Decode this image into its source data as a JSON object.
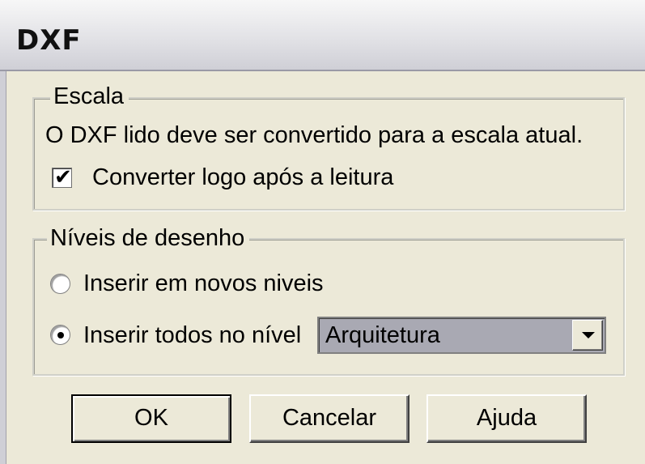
{
  "window": {
    "title": "DXF"
  },
  "escala_group": {
    "legend": "Escala",
    "description": "O DXF lido deve ser convertido para a escala atual.",
    "convert_checkbox": {
      "label": "Converter logo após a leitura",
      "checked": true
    }
  },
  "niveis_group": {
    "legend": "Níveis de desenho",
    "radio_new_levels": {
      "label": "Inserir em novos niveis",
      "selected": false
    },
    "radio_all_in_level": {
      "label": "Inserir todos no nível",
      "selected": true
    },
    "level_select": {
      "value": "Arquitetura"
    }
  },
  "buttons": {
    "ok": "OK",
    "cancel": "Cancelar",
    "help": "Ajuda"
  },
  "icons": {
    "check": "check-icon",
    "dropdown": "chevron-down-icon"
  }
}
